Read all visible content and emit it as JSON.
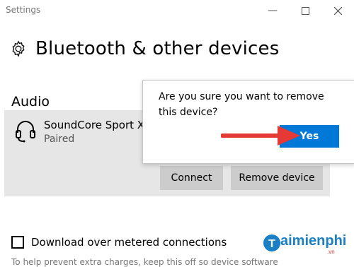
{
  "window": {
    "title": "Settings"
  },
  "page": {
    "title": "Bluetooth & other devices"
  },
  "audio": {
    "section_title": "Audio",
    "device": {
      "name": "SoundCore Sport XL",
      "status": "Paired",
      "connect_label": "Connect",
      "remove_label": "Remove device"
    }
  },
  "dialog": {
    "message": "Are you sure you want to remove this device?",
    "yes_label": "Yes"
  },
  "metered": {
    "label": "Download over metered connections",
    "checked": false
  },
  "watermark": {
    "text": "aimienphi",
    "domain": ".vn"
  },
  "footer": {
    "partial_text": "To help prevent extra charges, keep this off so device software"
  },
  "colors": {
    "accent": "#0078d7",
    "arrow": "#e53935",
    "panel": "#e6e6e6",
    "button": "#cccccc"
  },
  "icons": [
    "gear-icon",
    "headset-icon",
    "minimize-icon",
    "maximize-icon",
    "close-icon",
    "red-arrow-icon"
  ]
}
